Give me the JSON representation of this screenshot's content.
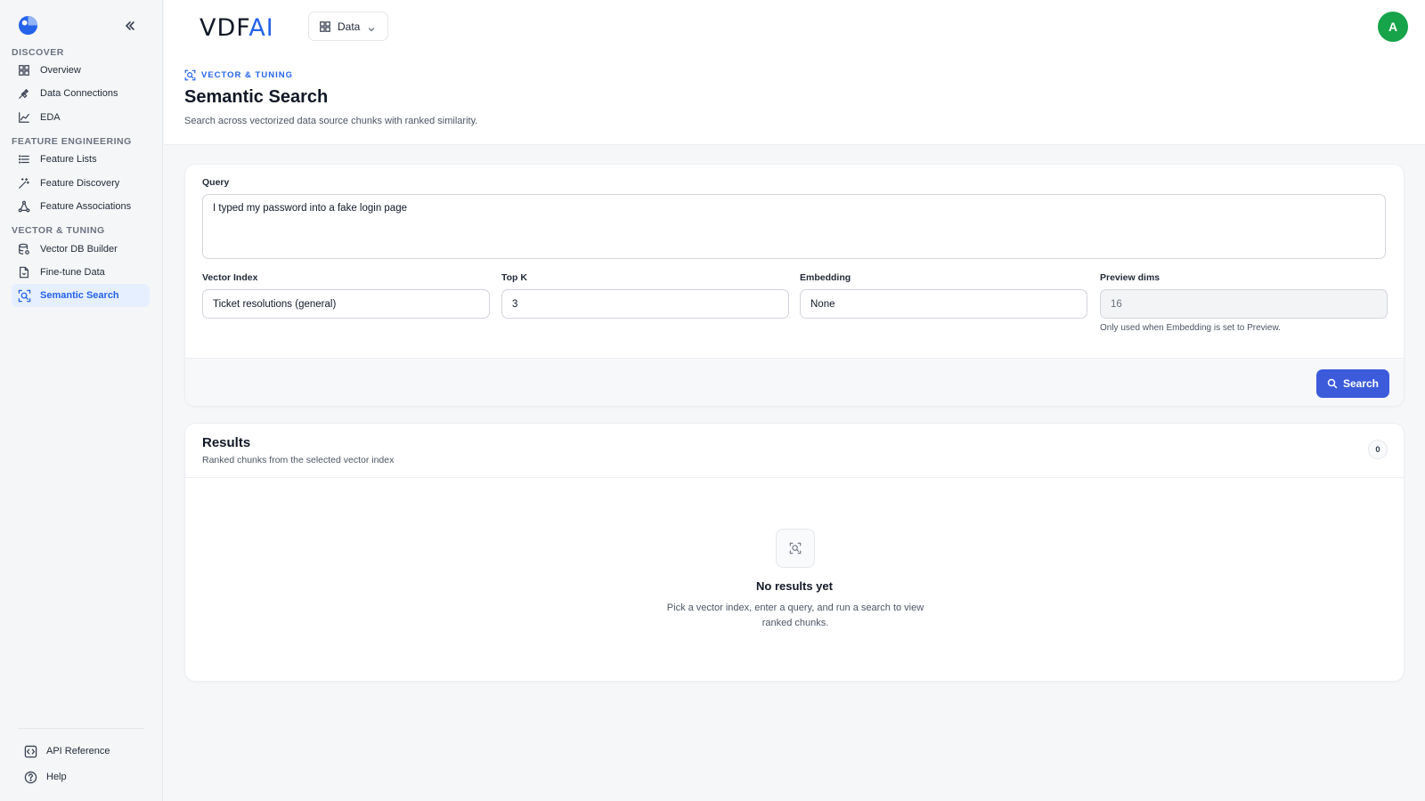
{
  "sidebar": {
    "sections": [
      {
        "label": "DISCOVER",
        "items": [
          {
            "label": "Overview",
            "icon": "grid-icon"
          },
          {
            "label": "Data Connections",
            "icon": "plug-icon"
          },
          {
            "label": "EDA",
            "icon": "chart-icon"
          }
        ]
      },
      {
        "label": "FEATURE ENGINEERING",
        "items": [
          {
            "label": "Feature Lists",
            "icon": "list-icon"
          },
          {
            "label": "Feature Discovery",
            "icon": "wand-icon"
          },
          {
            "label": "Feature Associations",
            "icon": "network-icon"
          }
        ]
      },
      {
        "label": "VECTOR & TUNING",
        "items": [
          {
            "label": "Vector DB Builder",
            "icon": "database-icon"
          },
          {
            "label": "Fine-tune Data",
            "icon": "file-icon"
          },
          {
            "label": "Semantic Search",
            "icon": "scan-search-icon",
            "active": true
          }
        ]
      }
    ],
    "footer": [
      {
        "label": "API Reference",
        "icon": "code-icon"
      },
      {
        "label": "Help",
        "icon": "help-icon"
      }
    ]
  },
  "header": {
    "brand_main": "VDF",
    "brand_accent": "AI",
    "workspace": "Data",
    "avatar_initial": "A"
  },
  "page": {
    "eyebrow": "VECTOR & TUNING",
    "title": "Semantic Search",
    "subtitle": "Search across vectorized data source chunks with ranked similarity."
  },
  "form": {
    "query_label": "Query",
    "query_value": "I typed my password into a fake login page",
    "vector_index_label": "Vector Index",
    "vector_index_value": "Ticket resolutions (general)",
    "topk_label": "Top K",
    "topk_value": "3",
    "embedding_label": "Embedding",
    "embedding_value": "None",
    "preview_dims_label": "Preview dims",
    "preview_dims_value": "16",
    "preview_hint": "Only used when Embedding is set to Preview.",
    "search_label": "Search"
  },
  "results": {
    "title": "Results",
    "subtitle": "Ranked chunks from the selected vector index",
    "count": "0",
    "empty_title": "No results yet",
    "empty_text": "Pick a vector index, enter a query, and run a search to view ranked chunks."
  },
  "colors": {
    "accent": "#2563eb",
    "button": "#3b5bdb",
    "avatar": "#16a34a"
  }
}
